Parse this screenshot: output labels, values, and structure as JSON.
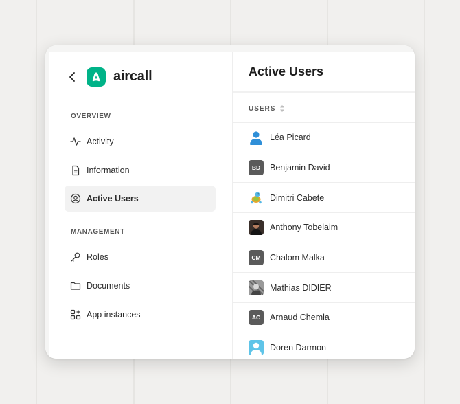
{
  "brand": {
    "name": "aircall",
    "accent": "#00b388"
  },
  "sidebar": {
    "sections": [
      {
        "label": "OVERVIEW",
        "items": [
          {
            "label": "Activity",
            "icon": "activity-icon"
          },
          {
            "label": "Information",
            "icon": "document-icon"
          },
          {
            "label": "Active Users",
            "icon": "user-circle-icon",
            "active": true
          }
        ]
      },
      {
        "label": "MANAGEMENT",
        "items": [
          {
            "label": "Roles",
            "icon": "key-icon"
          },
          {
            "label": "Documents",
            "icon": "folder-icon"
          },
          {
            "label": "App instances",
            "icon": "apps-icon"
          }
        ]
      }
    ]
  },
  "main": {
    "title": "Active Users",
    "column_header": "USERS",
    "users": [
      {
        "name": "Léa Picard",
        "avatar": "person-icon"
      },
      {
        "name": "Benjamin David",
        "initials": "BD"
      },
      {
        "name": "Dimitri Cabete",
        "avatar": "turtle-icon"
      },
      {
        "name": "Anthony Tobelaim",
        "avatar": "photo"
      },
      {
        "name": "Chalom Malka",
        "initials": "CM"
      },
      {
        "name": "Mathias DIDIER",
        "avatar": "photo"
      },
      {
        "name": "Arnaud Chemla",
        "initials": "AC"
      },
      {
        "name": "Doren Darmon",
        "avatar": "person-icon"
      }
    ]
  }
}
